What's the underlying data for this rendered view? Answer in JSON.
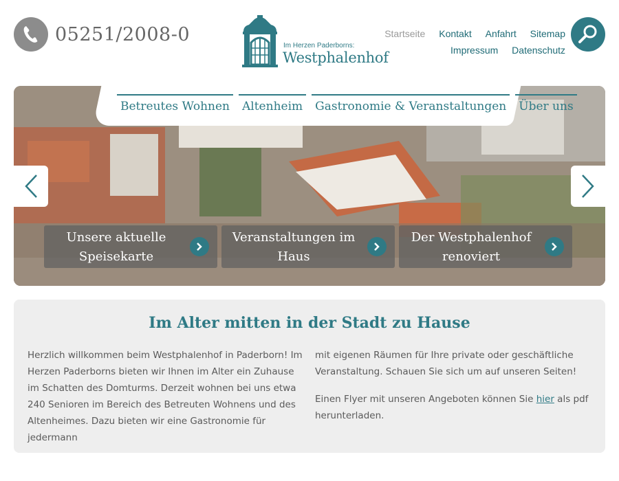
{
  "header": {
    "phone_icon": "phone-icon",
    "phone_number": "05251/2008-0",
    "logo_tagline": "Im Herzen Paderborns:",
    "logo_name": "Westphalenhof",
    "top_links_row1": [
      "Startseite",
      "Kontakt",
      "Anfahrt",
      "Sitemap"
    ],
    "top_links_row2": [
      "Impressum",
      "Datenschutz"
    ],
    "search_icon": "search-icon"
  },
  "main_nav": [
    "Betreutes Wohnen",
    "Altenheim",
    "Gastronomie & Veranstaltungen",
    "Über uns"
  ],
  "carousel": {
    "cards": [
      {
        "label": "Unsere aktuelle Speisekarte"
      },
      {
        "label": "Veranstaltungen im Haus"
      },
      {
        "label": "Der Westphalenhof renoviert"
      }
    ]
  },
  "intro": {
    "title": "Im Alter mitten in der Stadt zu Hause",
    "left_text": "Herzlich willkommen beim Westphalenhof in Paderborn! Im Herzen Paderborns bieten wir Ihnen im Alter ein Zuhause im Schatten des Domturms. Derzeit wohnen bei uns etwa 240 Senioren im Bereich des Betreuten Wohnens und des Altenheimes. Dazu bieten wir eine Gastronomie für jedermann",
    "right_text_1": "mit eigenen Räumen für Ihre private oder geschäftliche Veranstaltung. Schauen Sie sich um auf unseren Seiten!",
    "right_text_2_before": "Einen Flyer mit unseren Angeboten können Sie ",
    "right_text_2_link": "hier",
    "right_text_2_after": " als pdf herunterladen."
  },
  "colors": {
    "accent": "#2f7a85",
    "muted": "#9a9a9a",
    "panel": "#eeeeee"
  }
}
